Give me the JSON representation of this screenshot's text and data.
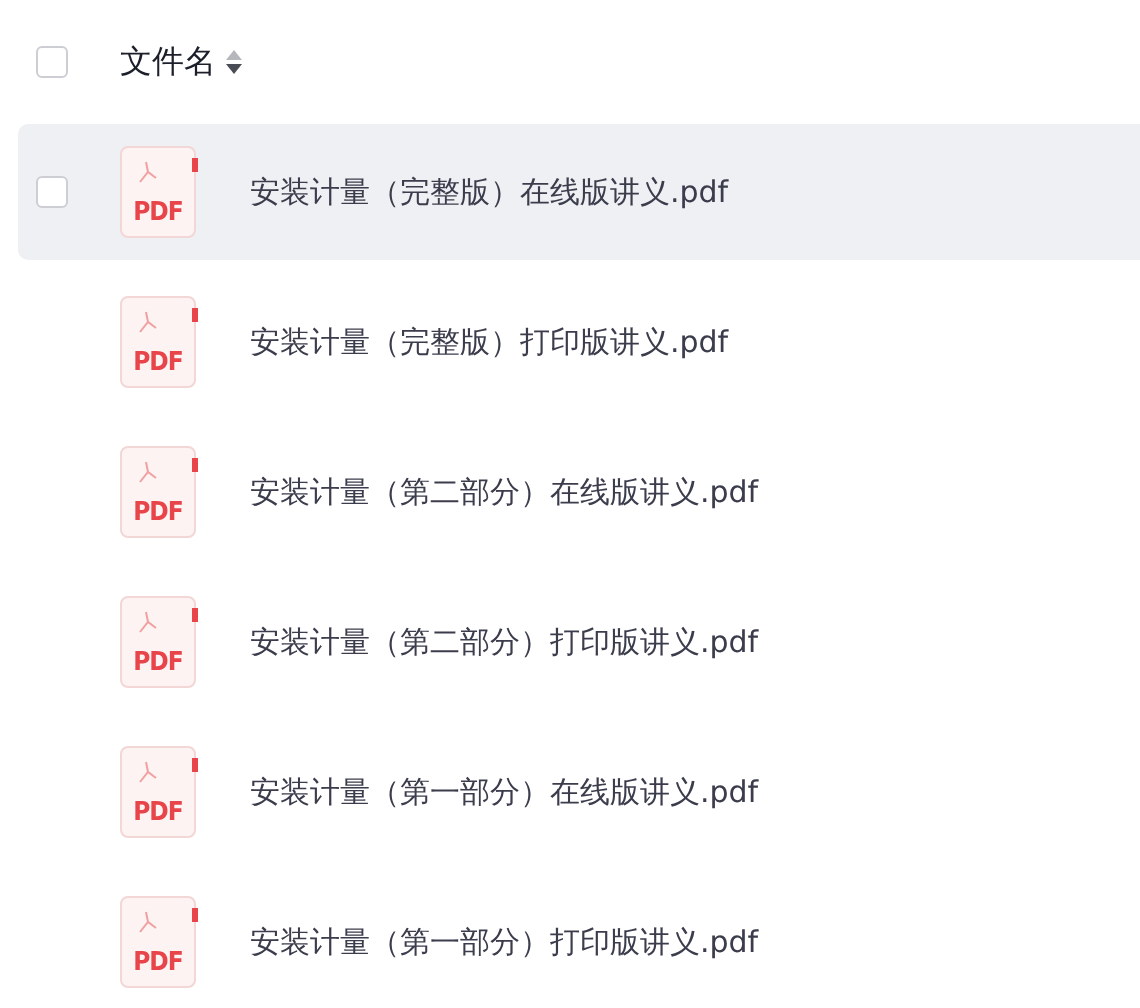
{
  "header": {
    "title": "文件名",
    "checked": false
  },
  "files": [
    {
      "name": "安装计量（完整版）在线版讲义.pdf",
      "badge": "PDF",
      "hovered": true,
      "checked": false
    },
    {
      "name": "安装计量（完整版）打印版讲义.pdf",
      "badge": "PDF",
      "hovered": false,
      "checked": false
    },
    {
      "name": "安装计量（第二部分）在线版讲义.pdf",
      "badge": "PDF",
      "hovered": false,
      "checked": false
    },
    {
      "name": "安装计量（第二部分）打印版讲义.pdf",
      "badge": "PDF",
      "hovered": false,
      "checked": false
    },
    {
      "name": "安装计量（第一部分）在线版讲义.pdf",
      "badge": "PDF",
      "hovered": false,
      "checked": false
    },
    {
      "name": "安装计量（第一部分）打印版讲义.pdf",
      "badge": "PDF",
      "hovered": false,
      "checked": false
    }
  ]
}
